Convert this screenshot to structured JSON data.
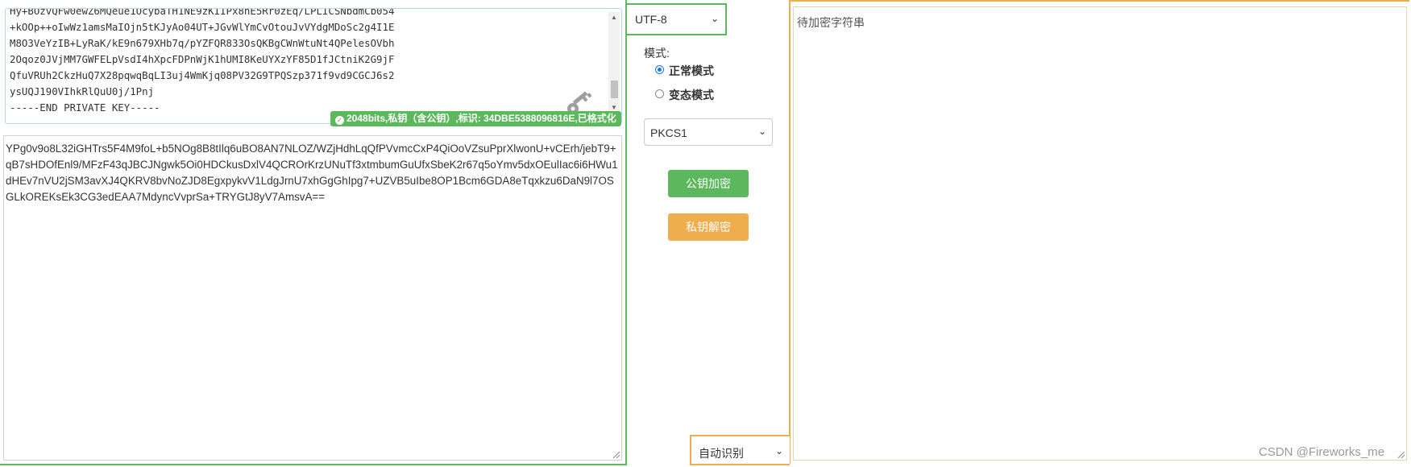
{
  "key_area": {
    "lines": [
      "Hy+BOzvQFw0ewZ6MQeue1OcybaTH1NE9zKIIPx8nE5Rr0zEq/LPLICSNbdmCb054",
      "+kOOp++oIwWz1amsMaIOjn5tKJyAo04UT+JGvWlYmCvOtouJvVYdgMDoSc2g4I1E",
      "M8O3VeYzIB+LyRaK/kE9n679XHb7q/pYZFQR833OsQKBgCWnWtuNt4QPelesOVbh",
      "2Oqoz0JVjMM7GWFELpVsdI4hXpcFDPnWjK1hUMI8KeUYXzYF85D1fJCtniK2G9jF",
      "QfuVRUh2CkzHuQ7X28pqwqBqLI3uj4WmKjq08PV32G9TPQSzp371f9vd9CGCJ6s2",
      "ysUQJ190VIhkRlQuU0j/1Pnj",
      "-----END PRIVATE KEY-----"
    ],
    "badge": "2048bits,私钥（含公钥）,标识: 34DBE5388096816E,已格式化",
    "icon": "key-icon"
  },
  "cipher_text": "YPg0v9o8L32iGHTrs5F4M9foL+b5NOg8B8tIlq6uBO8AN7NLOZ/WZjHdhLqQfPVvmcCxP4QiOoVZsuPprXlwonU+vCErh/jebT9+qB7sHDOfEnl9/MFzF43qJBCJNgwk5Oi0HDCkusDxlV4QCROrKrzUNuTf3xtmbumGuUfxSbeK2r67q5oYmv5dxOEulIac6i6HWu1dHEv7nVU2jSM3avXJ4QKRV8bvNoZJD8EgxpykvV1LdgJrnU7xhGgGhIpg7+UZVB5uIbe8OP1Bcm6GDA8eTqxkzu6DaN9l7OSGLkOREKsEk3CG3edEAA7MdyncVvprSa+TRYGtJ8yV7AmsvA==",
  "charset": {
    "selected": "UTF-8"
  },
  "mode": {
    "label": "模式:",
    "options": [
      {
        "label": "正常模式",
        "checked": true
      },
      {
        "label": "变态模式",
        "checked": false
      }
    ]
  },
  "padding": {
    "selected": "PKCS1"
  },
  "buttons": {
    "encrypt": "公钥加密",
    "decrypt": "私钥解密"
  },
  "output": {
    "placeholder": "待加密字符串",
    "detect_selected": "自动识别"
  },
  "watermark": "CSDN @Fireworks_me",
  "colors": {
    "green": "#5cb85c",
    "orange": "#f0ad4e",
    "radio": "#1a73e8"
  }
}
